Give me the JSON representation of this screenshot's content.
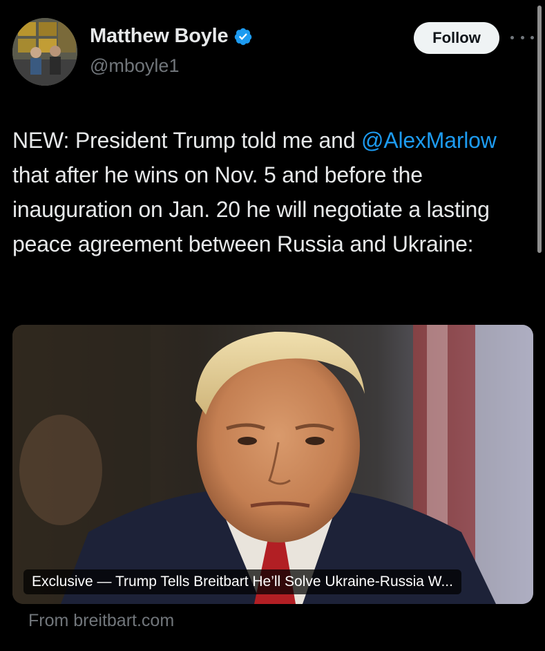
{
  "author": {
    "display_name": "Matthew Boyle",
    "handle": "@mboyle1",
    "verified": true,
    "avatar_icon": "avatar-photo",
    "verified_icon": "verified-badge-icon",
    "verified_color": "#1d9bf0"
  },
  "actions": {
    "follow_label": "Follow",
    "more_icon": "more-options-icon"
  },
  "tweet": {
    "text_part1": "NEW: President Trump told me and ",
    "mention": "@AlexMarlow",
    "text_part2": " that after he wins on Nov. 5 and before the inauguration on Jan. 20 he will negotiate a lasting peace agreement between Russia and Ukraine:",
    "mention_color": "#1d9bf0"
  },
  "link_card": {
    "headline": "Exclusive — Trump Tells Breitbart He’ll Solve Ukraine-Russia W...",
    "source": "From breitbart.com"
  },
  "colors": {
    "background": "#000000",
    "text_primary": "#e7e9ea",
    "text_secondary": "#71767b",
    "button_bg": "#eff3f4"
  }
}
